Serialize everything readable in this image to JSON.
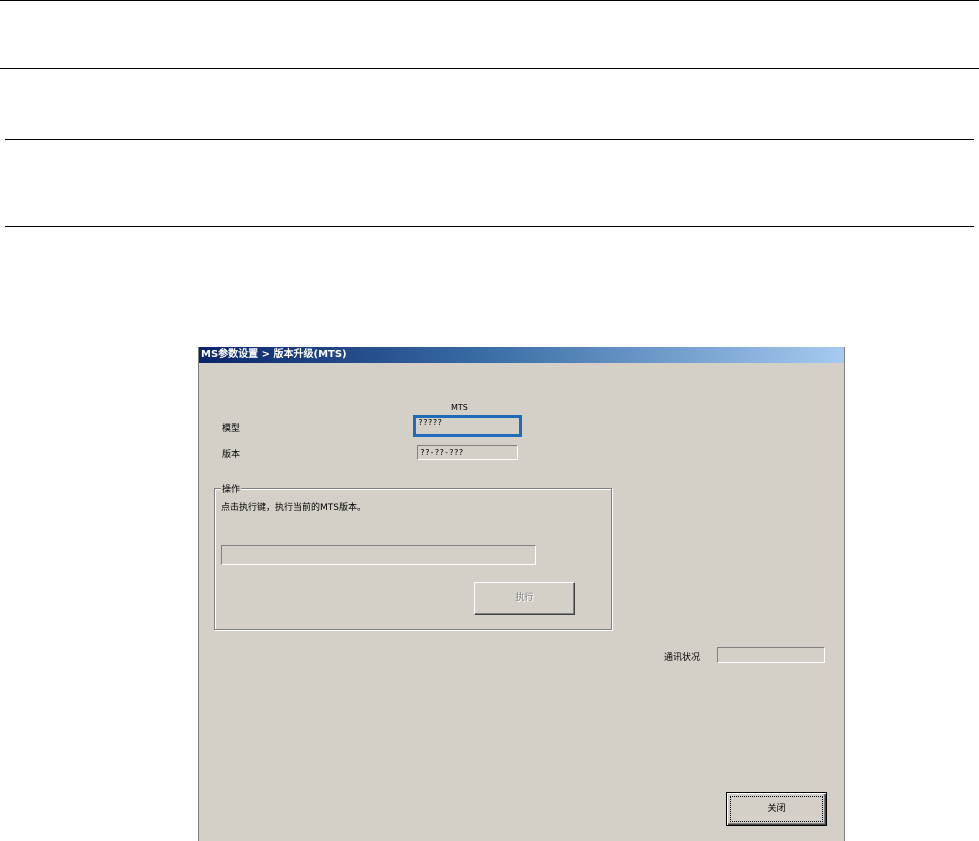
{
  "window": {
    "title": "MS参数设置 > 版本升级(MTS)"
  },
  "form": {
    "column_header": "MTS",
    "model_label": "模型",
    "model_value": "?????",
    "version_label": "版本",
    "version_value": "??-??-???"
  },
  "operation": {
    "group_title": "操作",
    "instruction": "点击执行键，执行当前的MTS版本。",
    "progress_percent": 0,
    "execute_label": "执行"
  },
  "status": {
    "comm_label": "通讯状况",
    "comm_value": ""
  },
  "footer": {
    "close_label": "关闭"
  },
  "colors": {
    "window_bg": "#d4d0c8",
    "titlebar_start": "#0a246a",
    "titlebar_end": "#a6caf0",
    "focus_border": "#1e6bb8"
  }
}
